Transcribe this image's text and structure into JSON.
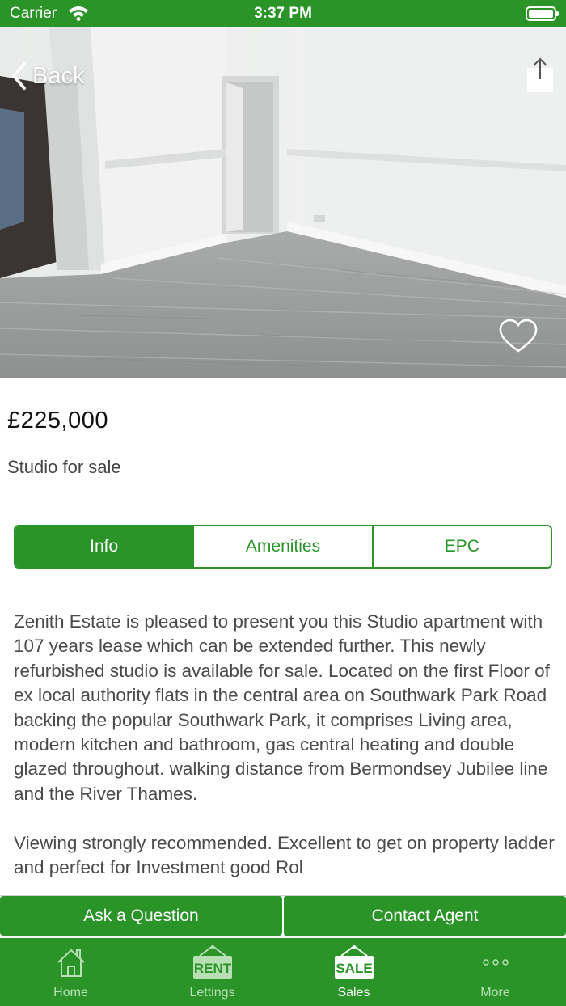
{
  "status_bar": {
    "carrier": "Carrier",
    "time": "3:37 PM"
  },
  "navigation": {
    "back_label": "Back",
    "share_icon": "share-icon",
    "favorite_icon": "heart-outline-icon"
  },
  "listing": {
    "price": "£225,000",
    "property_type": "Studio for sale"
  },
  "detail_tabs": [
    {
      "label": "Info",
      "active": true
    },
    {
      "label": "Amenities",
      "active": false
    },
    {
      "label": "EPC",
      "active": false
    }
  ],
  "description": {
    "paragraph_1": "Zenith Estate is pleased to present you this Studio apartment with 107 years lease which can be extended further. This newly refurbished studio is available for sale. Located on the first Floor of ex local authority flats in the central area on Southwark Park Road backing the popular Southwark Park, it comprises Living area, modern kitchen and bathroom, gas central heating and double glazed throughout. walking distance from Bermondsey Jubilee line and the River Thames.",
    "paragraph_2": "Viewing strongly recommended. Excellent to get on property ladder and perfect for Investment good Rol"
  },
  "actions": {
    "ask_question": "Ask a Question",
    "contact_agent": "Contact Agent"
  },
  "tab_bar": [
    {
      "label": "Home",
      "icon": "house-icon",
      "active": false
    },
    {
      "label": "Lettings",
      "icon": "rent-sign-icon",
      "icon_text": "RENT",
      "active": false
    },
    {
      "label": "Sales",
      "icon": "sale-sign-icon",
      "icon_text": "SALE",
      "active": true
    },
    {
      "label": "More",
      "icon": "ellipsis-icon",
      "active": false
    }
  ],
  "colors": {
    "brand_green": "#2a9428",
    "inactive_tab_label": "#b9e0b5",
    "text": "#4a4a4a"
  }
}
